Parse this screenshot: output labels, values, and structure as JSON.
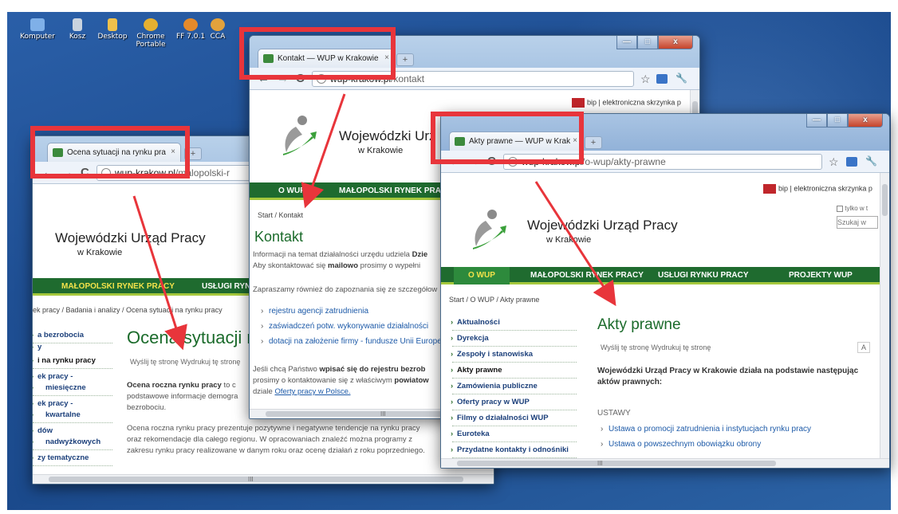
{
  "desktop": {
    "icons": [
      {
        "label": "Komputer",
        "icon": "computer-icon",
        "color": "#7fb0e8"
      },
      {
        "label": "Kosz",
        "icon": "recycle-bin-icon",
        "color": "#c9d3df"
      },
      {
        "label": "Desktop",
        "icon": "folder-icon",
        "color": "#f0c14b"
      },
      {
        "label": "Chrome Portable",
        "icon": "chrome-icon",
        "color": "#e6b030"
      },
      {
        "label": "FF 7.0.1",
        "icon": "firefox-icon",
        "color": "#e58a2a"
      },
      {
        "label": "CCA",
        "icon": "cca-icon",
        "color": "#e2a23c"
      }
    ]
  },
  "browser_common": {
    "back_glyph": "←",
    "forward_glyph": "→",
    "reload_glyph": "C",
    "star_glyph": "☆",
    "wrench_glyph": "🔧",
    "new_tab_glyph": "+",
    "tab_close_glyph": "×",
    "minimize_glyph": "—",
    "maximize_glyph": "□",
    "close_glyph": "x",
    "scroll_dots": "III"
  },
  "window_ocena": {
    "tab_title": "Ocena sytuacji na rynku pra",
    "url_host": "wup-krakow.pl",
    "url_path": "/malopolski-r",
    "org_name": "Wojewódzki Urząd Pracy",
    "org_sub": "w Krakowie",
    "menu": [
      "MAŁOPOLSKI RYNEK PRACY",
      "USŁUGI RYNK"
    ],
    "breadcrumb": "ek pracy / Badania i analizy / Ocena sytuacji na rynku pracy",
    "heading": "Ocena sytuacji r",
    "actions": "Wyślij tę stronę   Wydrukuj tę stronę",
    "side_items": [
      "a bezrobocia",
      "y",
      "i na rynku pracy",
      "ek pracy -",
      "miesięczne",
      "ek pracy -",
      "kwartalne",
      "dów",
      "nadwyżkowych",
      "zy tematyczne"
    ],
    "intro_bold": "Ocena roczna rynku pracy",
    "intro_rest": " to c",
    "intro_line2": "podstawowe informacje demogra",
    "intro_line3": "bezrobociu.",
    "body": "Ocena roczna rynku pracy prezentuje pozytywne i negatywne tendencje na rynku pracy oraz rekomendacje dla całego regionu. W opracowaniach znaleźć można programy z zakresu rynku pracy realizowane w danym roku oraz ocenę działań z roku poprzedniego."
  },
  "window_kontakt": {
    "tab_title": "Kontakt — WUP w Krakowie",
    "url_host": "wup-krakow.pl",
    "url_path": "/kontakt",
    "top_links": [
      "bip",
      "elektroniczna skrzynka p"
    ],
    "org_name": "Wojewódzki Urz",
    "org_sub": "w Krakowie",
    "menu": [
      "O WUP",
      "MAŁOPOLSKI RYNEK PRAC"
    ],
    "breadcrumb": "Start / Kontakt",
    "heading": "Kontakt",
    "para1_line1": "Informacji na temat działalności urzędu udziela ",
    "para1_line1_bold": "Dzie",
    "para1_line2a": "Aby skontaktować się ",
    "para1_line2_bold": "mailowo",
    "para1_line2b": " prosimy o wypełni",
    "para2": "Zapraszamy również do zapoznania się ze szczegółow",
    "links": [
      "rejestru agencji zatrudnienia",
      "zaświadczeń potw. wykonywanie działalności",
      "dotacji na założenie firmy - fundusze Unii Europej"
    ],
    "para3a": "Jeśli chcą Państwo ",
    "para3_bold": "wpisać się do rejestru bezrob",
    "para3b": "prosimy o kontaktowanie się z właściwym ",
    "para3_bold2": "powiatow",
    "para3c": "dziale ",
    "para3_link": "Oferty pracy w Polsce."
  },
  "window_akty": {
    "tab_title": "Akty prawne — WUP w Krak",
    "url_host": "wup-krakow.pl",
    "url_path": "/o-wup/akty-prawne",
    "top_links": [
      "bip",
      "elektroniczna skrzynka p"
    ],
    "search_option": "tylko w t",
    "search_placeholder": "Szukaj w",
    "org_name": "Wojewódzki Urząd Pracy",
    "org_sub": "w Krakowie",
    "menu": [
      "O WUP",
      "MAŁOPOLSKI RYNEK PRACY",
      "USŁUGI RYNKU PRACY",
      "PROJEKTY WUP"
    ],
    "breadcrumb": "Start / O WUP / Akty prawne",
    "side_items": [
      "Aktualności",
      "Dyrekcja",
      "Zespoły i stanowiska",
      "Akty prawne",
      "Zamówienia publiczne",
      "Oferty pracy w WUP",
      "Filmy o działalności WUP",
      "Euroteka",
      "Przydatne kontakty i odnośniki"
    ],
    "heading": "Akty prawne",
    "actions": "Wyślij tę stronę   Wydrukuj tę stronę",
    "font_size_label": "A",
    "intro": "Wojewódzki Urząd Pracy w Krakowie działa na podstawie następując aktów prawnych:",
    "section": "USTAWY",
    "links": [
      "Ustawa o promocji zatrudnienia i instytucjach rynku pracy",
      "Ustawa o powszechnym obowiązku obrony"
    ]
  },
  "annotations": {
    "color": "#e8353b"
  }
}
